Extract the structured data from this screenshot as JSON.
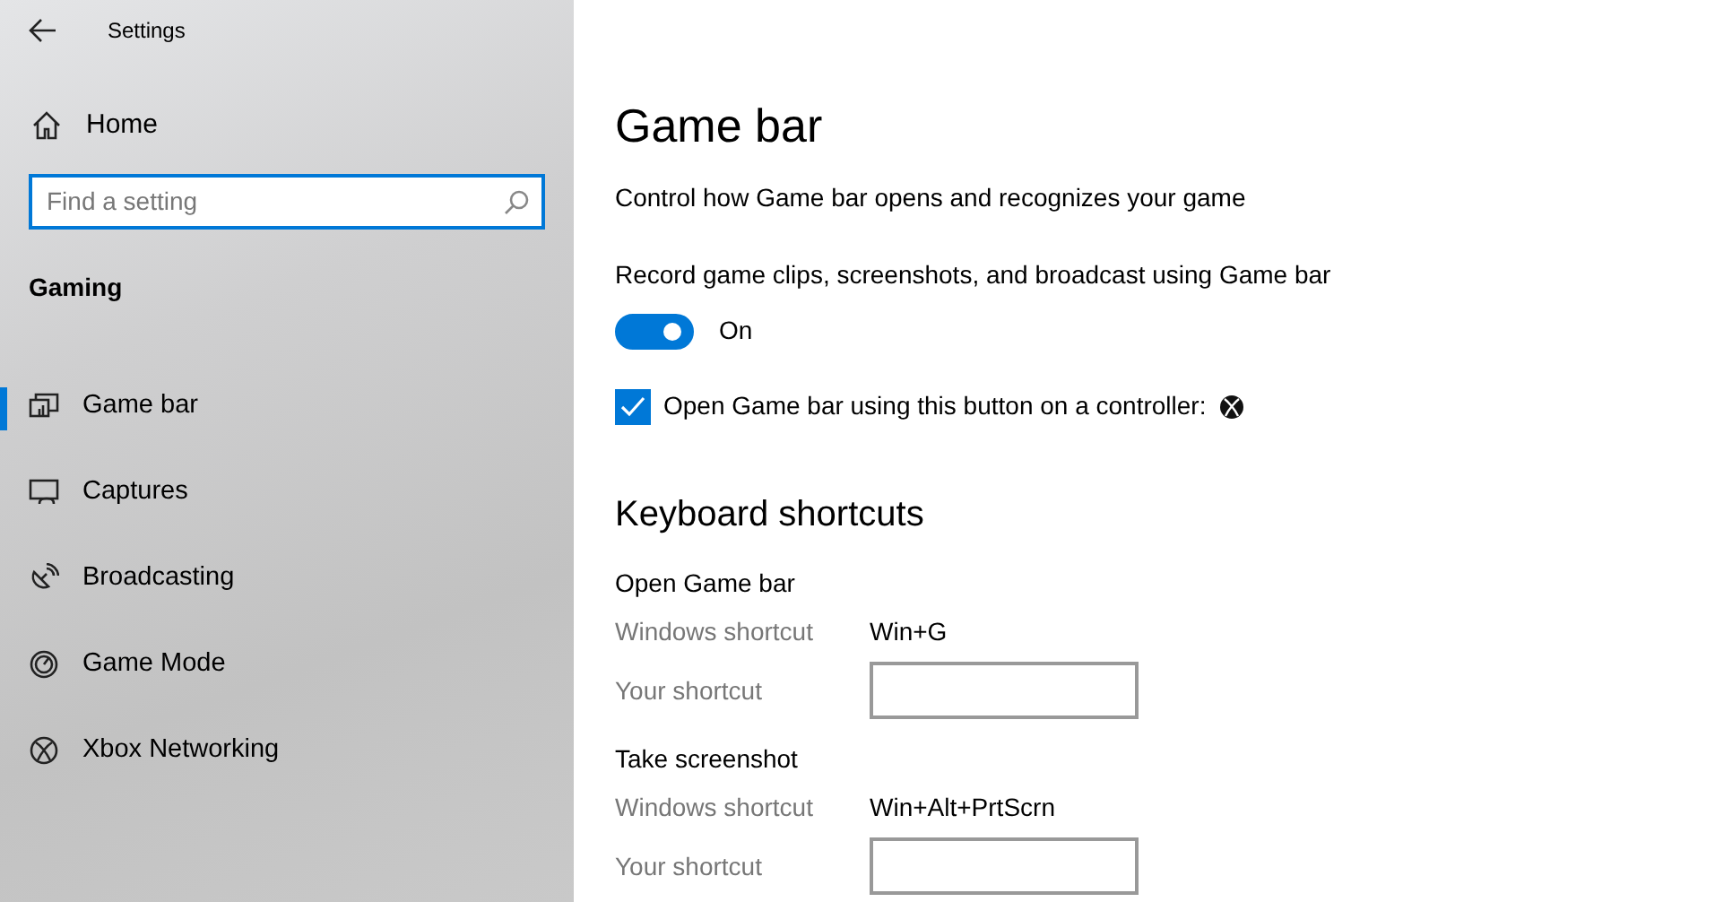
{
  "window": {
    "title": "Settings"
  },
  "sidebar": {
    "home": "Home",
    "search": {
      "placeholder": "Find a setting"
    },
    "section": "Gaming",
    "items": [
      {
        "label": "Game bar",
        "kind": "gamebar",
        "selected": true
      },
      {
        "label": "Captures",
        "kind": "captures",
        "selected": false
      },
      {
        "label": "Broadcasting",
        "kind": "broadcasting",
        "selected": false
      },
      {
        "label": "Game Mode",
        "kind": "gamemode",
        "selected": false
      },
      {
        "label": "Xbox Networking",
        "kind": "xbox",
        "selected": false
      }
    ]
  },
  "main": {
    "title": "Game bar",
    "description": "Control how Game bar opens and recognizes your game",
    "record": {
      "label": "Record game clips, screenshots, and broadcast using Game bar",
      "on": true,
      "state_text": "On"
    },
    "controller_option": {
      "label": "Open Game bar using this button on a controller:",
      "checked": true
    },
    "shortcuts": {
      "heading": "Keyboard shortcuts",
      "groups": [
        {
          "name": "Open Game bar",
          "windows_label": "Windows shortcut",
          "windows_value": "Win+G",
          "custom_label": "Your shortcut"
        },
        {
          "name": "Take screenshot",
          "windows_label": "Windows shortcut",
          "windows_value": "Win+Alt+PrtScrn",
          "custom_label": "Your shortcut"
        }
      ]
    }
  }
}
